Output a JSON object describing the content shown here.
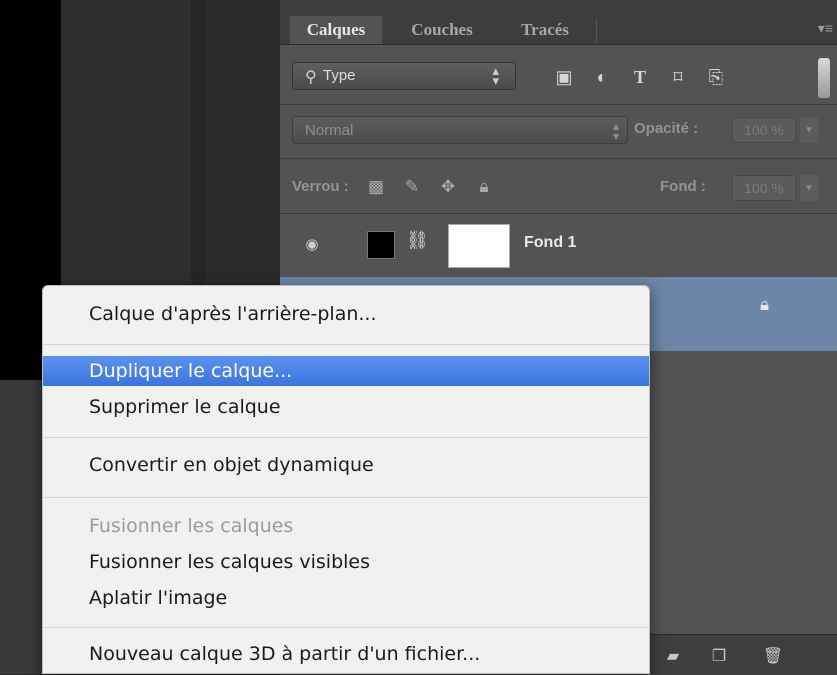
{
  "panel": {
    "tabs": [
      {
        "label": "Calques",
        "active": true
      },
      {
        "label": "Couches",
        "active": false
      },
      {
        "label": "Tracés",
        "active": false
      }
    ],
    "filter": {
      "label": "Type",
      "icons": [
        "image-filter-icon",
        "adjustment-filter-icon",
        "type-filter-icon",
        "shape-filter-icon",
        "smart-object-filter-icon"
      ]
    },
    "blend_mode": "Normal",
    "opacity_label": "Opacité :",
    "opacity_value": "100 %",
    "lock_label": "Verrou :",
    "fill_label": "Fond :",
    "fill_value": "100 %",
    "layers": [
      {
        "name": "Fond 1"
      }
    ]
  },
  "context_menu": {
    "items": [
      {
        "label": "Calque d'après l'arrière-plan...",
        "state": "normal"
      },
      {
        "label": "Dupliquer le calque...",
        "state": "highlighted"
      },
      {
        "label": "Supprimer le calque",
        "state": "normal"
      },
      {
        "label": "Convertir en objet dynamique",
        "state": "normal"
      },
      {
        "label": "Fusionner les calques",
        "state": "disabled"
      },
      {
        "label": "Fusionner les calques visibles",
        "state": "normal"
      },
      {
        "label": "Aplatir l'image",
        "state": "normal"
      },
      {
        "label": "Nouveau calque 3D à partir d'un fichier...",
        "state": "normal"
      }
    ]
  },
  "colors": {
    "panel_bg": "#535353",
    "selected_layer": "#6e87a8",
    "menu_highlight": "#3a74de"
  }
}
